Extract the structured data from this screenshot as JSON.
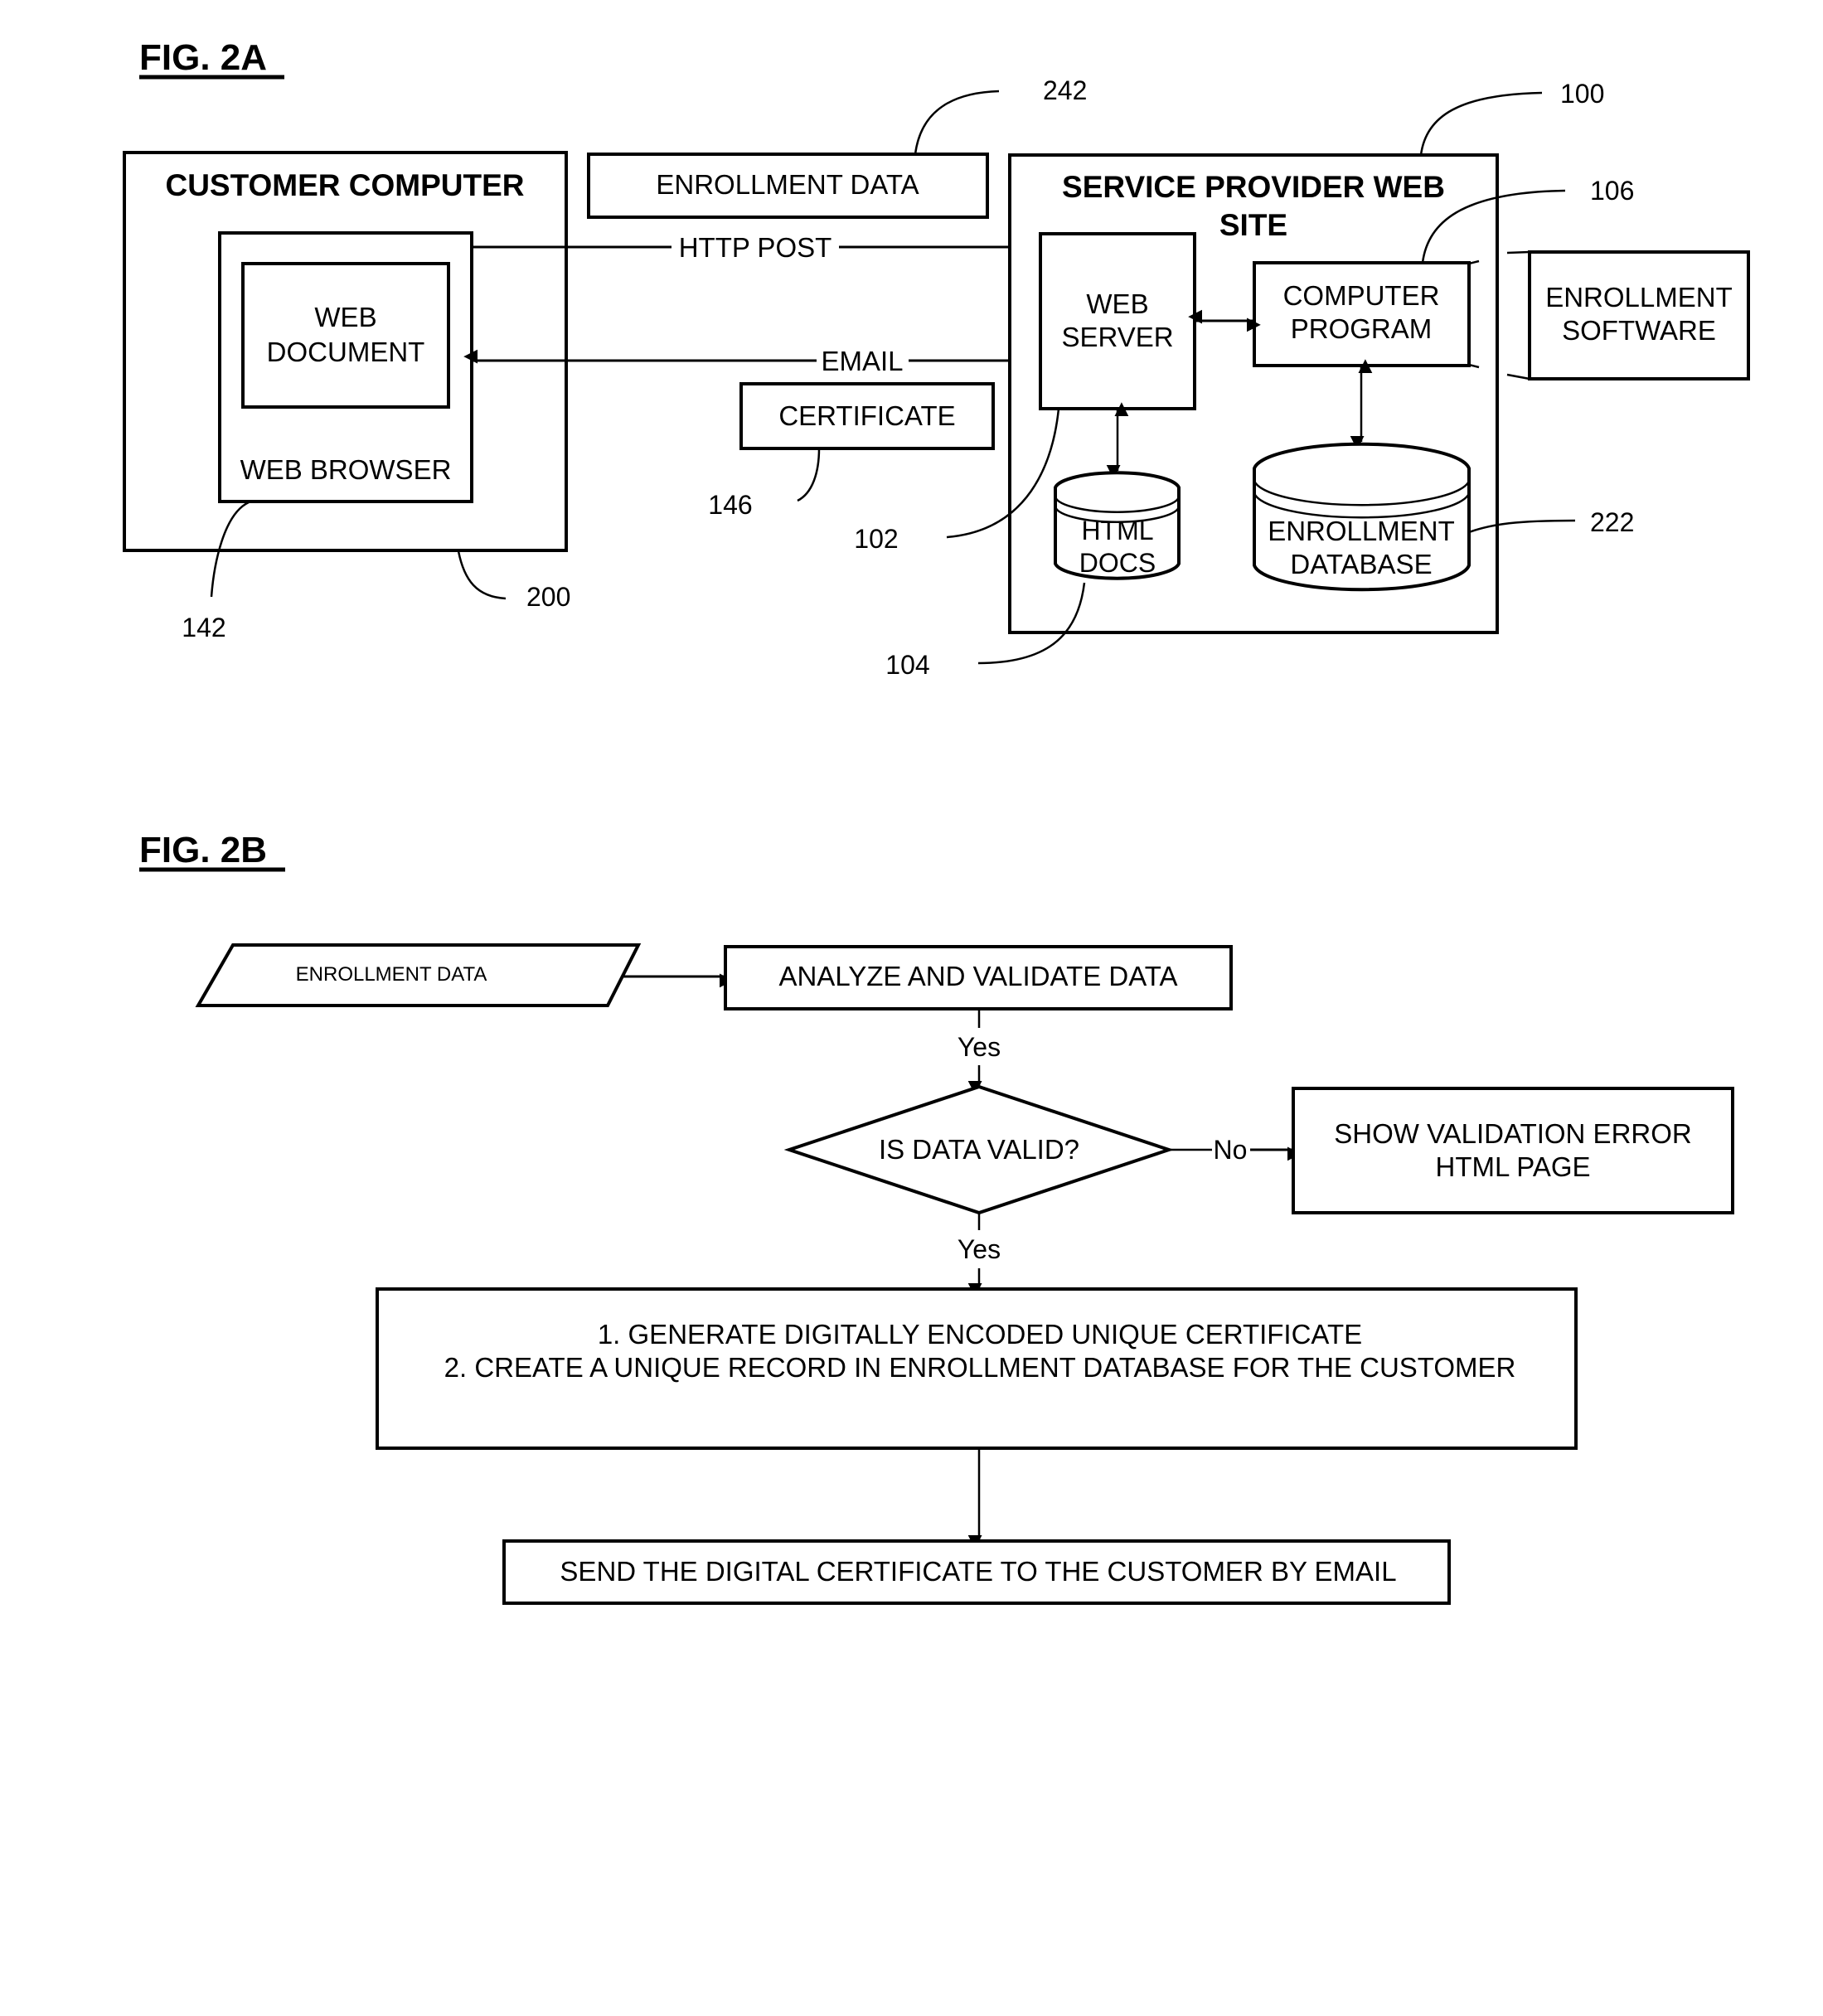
{
  "fig_2a": {
    "title": "FIG. 2A",
    "customer_computer": {
      "title": "CUSTOMER COMPUTER",
      "ref": "200"
    },
    "web_browser": {
      "label": "WEB BROWSER",
      "ref": "142"
    },
    "web_document": {
      "line1": "WEB",
      "line2": "DOCUMENT"
    },
    "enrollment_data": {
      "label": "ENROLLMENT DATA",
      "ref": "242"
    },
    "http_post": "HTTP POST",
    "email": "EMAIL",
    "certificate": {
      "label": "CERTIFICATE",
      "ref": "146"
    },
    "service_provider": {
      "line1": "SERVICE PROVIDER WEB",
      "line2": "SITE",
      "ref": "100"
    },
    "web_server": {
      "line1": "WEB",
      "line2": "SERVER",
      "ref": "102"
    },
    "computer_program": {
      "line1": "COMPUTER",
      "line2": "PROGRAM",
      "ref": "106"
    },
    "enrollment_software": {
      "line1": "ENROLLMENT",
      "line2": "SOFTWARE"
    },
    "html_docs": {
      "line1": "HTML",
      "line2": "DOCS",
      "ref": "104"
    },
    "enrollment_database": {
      "line1": "ENROLLMENT",
      "line2": "DATABASE",
      "ref": "222"
    }
  },
  "fig_2b": {
    "title": "FIG. 2B",
    "input": "ENROLLMENT DATA",
    "analyze": "ANALYZE AND VALIDATE DATA",
    "yes_1": "Yes",
    "decision": "IS DATA VALID?",
    "no": "No",
    "error": {
      "line1": "SHOW VALIDATION ERROR",
      "line2": "HTML PAGE"
    },
    "yes_2": "Yes",
    "generate": {
      "line1": "1. GENERATE DIGITALLY ENCODED UNIQUE CERTIFICATE",
      "line2": "2. CREATE A UNIQUE RECORD IN ENROLLMENT DATABASE FOR THE CUSTOMER"
    },
    "send": "SEND THE DIGITAL CERTIFICATE TO THE CUSTOMER BY EMAIL"
  }
}
